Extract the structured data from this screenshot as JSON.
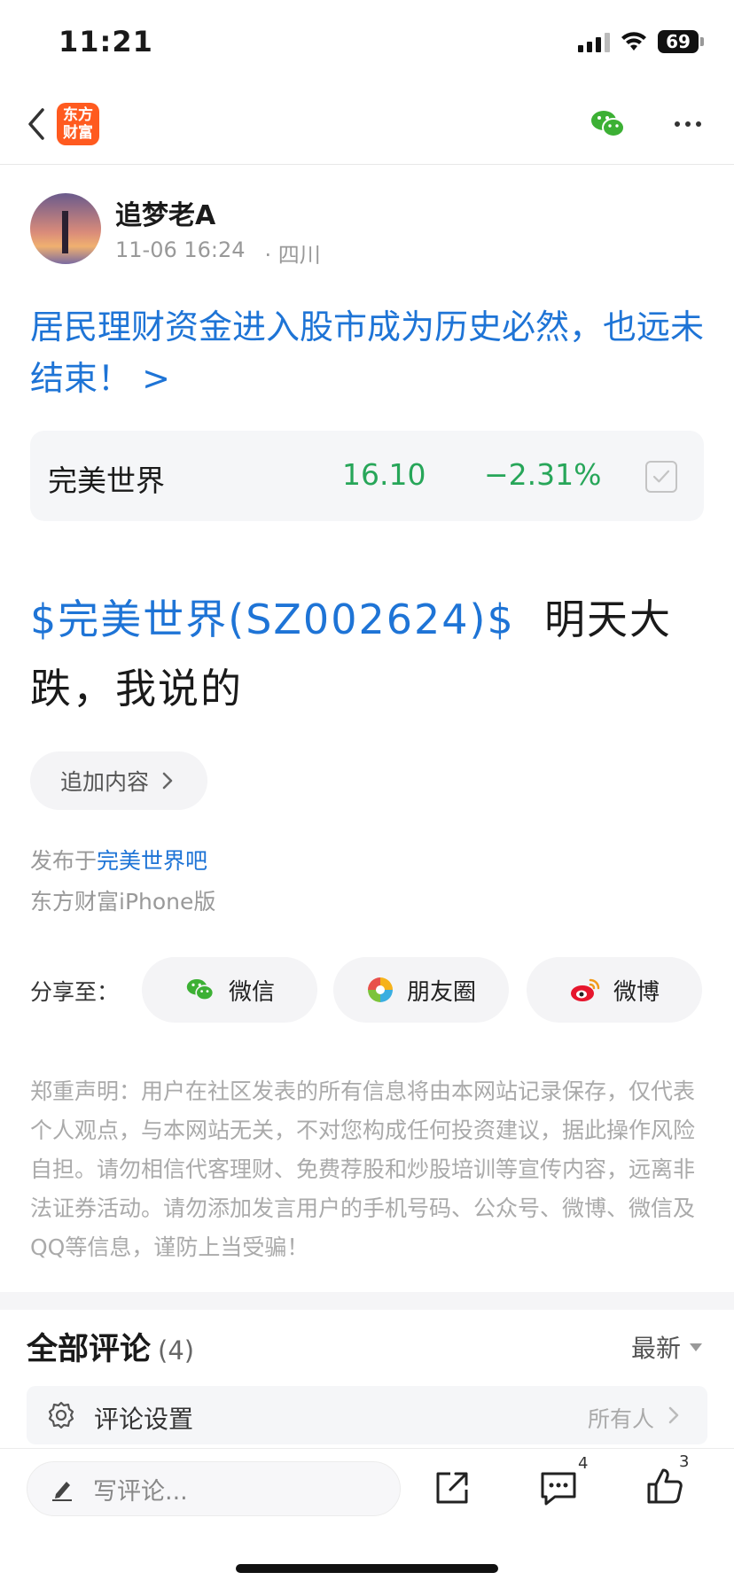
{
  "status_bar": {
    "time": "11:21",
    "battery": "69"
  },
  "navbar": {
    "logo_line1": "东方",
    "logo_line2": "财富"
  },
  "author": {
    "name": "追梦老A",
    "datetime": "11-06 16:24",
    "location": "· 四川"
  },
  "post": {
    "title": "居民理财资金进入股市成为历史必然，也远未结束！ >",
    "stock_link": "$完美世界(SZ002624)$",
    "body_text": "  明天大跌，我说的",
    "append_label": "追加内容",
    "published_prefix": "发布于",
    "published_bar": "完美世界吧",
    "client": "东方财富iPhone版"
  },
  "stock_card": {
    "name": "完美世界",
    "price": "16.10",
    "change": "−2.31%",
    "color": "#27a659"
  },
  "share": {
    "label": "分享至：",
    "wechat": "微信",
    "moments": "朋友圈",
    "weibo": "微博"
  },
  "disclaimer": "郑重声明：用户在社区发表的所有信息将由本网站记录保存，仅代表个人观点，与本网站无关，不对您构成任何投资建议，据此操作风险自担。请勿相信代客理财、免费荐股和炒股培训等宣传内容，远离非法证券活动。请勿添加发言用户的手机号码、公众号、微博、微信及QQ等信息，谨防上当受骗！",
  "comments": {
    "title": "全部评论",
    "count": "(4)",
    "sort": "最新",
    "settings_label": "评论设置",
    "settings_value": "所有人"
  },
  "bottom_bar": {
    "input_placeholder": "写评论...",
    "comment_badge": "4",
    "like_badge": "3"
  },
  "colors": {
    "link_blue": "#1e74d6",
    "brand_orange": "#ff5a1f",
    "wechat_green": "#3cb034"
  }
}
